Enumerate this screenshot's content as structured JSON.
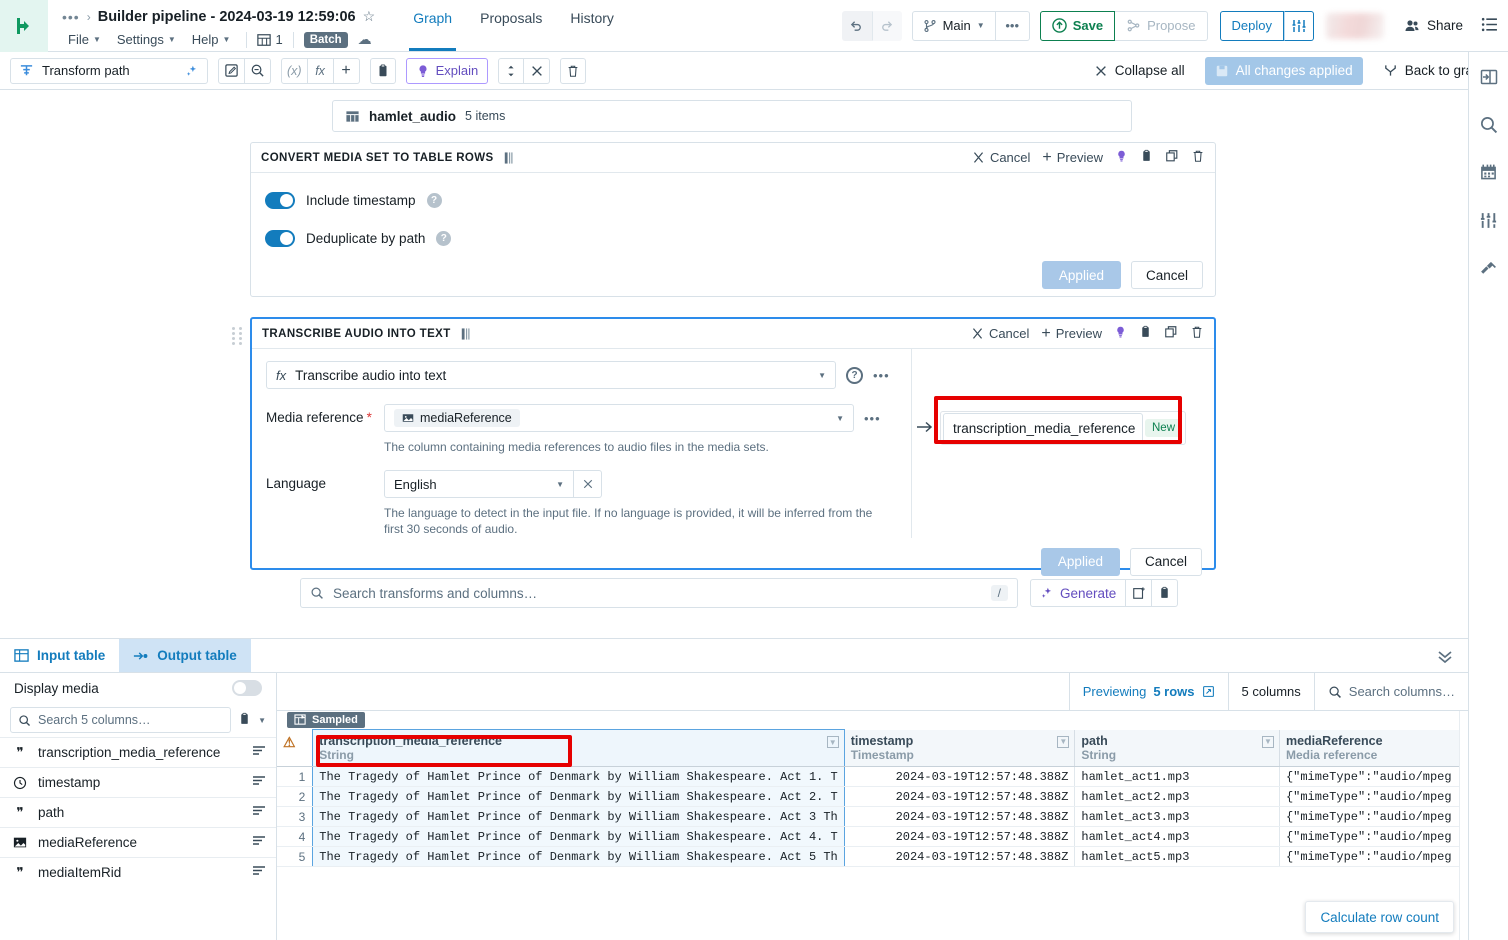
{
  "topbar": {
    "breadcrumb_dots": "•••",
    "breadcrumb_sep": "›",
    "doc_title": "Builder pipeline - 2024-03-19 12:59:06",
    "menus": [
      "File",
      "Settings",
      "Help"
    ],
    "branch_count": "1",
    "batch_label": "Batch",
    "tabs": [
      {
        "label": "Graph",
        "active": true
      },
      {
        "label": "Proposals",
        "active": false
      },
      {
        "label": "History",
        "active": false
      }
    ],
    "branch_name": "Main",
    "save_label": "Save",
    "propose_label": "Propose",
    "deploy_label": "Deploy",
    "share_label": "Share"
  },
  "toolbar": {
    "path_label": "Transform path",
    "explain_label": "Explain",
    "collapse_all_label": "Collapse all",
    "all_changes_label": "All changes applied",
    "back_to_graph_label": "Back to graph"
  },
  "canvas": {
    "node": {
      "name": "hamlet_audio",
      "count": "5 items"
    },
    "card_actions": {
      "cancel": "Cancel",
      "preview": "Preview"
    },
    "convert_card": {
      "title": "CONVERT MEDIA SET TO TABLE ROWS",
      "toggles": [
        {
          "label": "Include timestamp",
          "on": true
        },
        {
          "label": "Deduplicate by path",
          "on": true
        }
      ],
      "applied_label": "Applied",
      "cancel_label": "Cancel"
    },
    "transcribe_card": {
      "title": "TRANSCRIBE AUDIO INTO TEXT",
      "function_name": "Transcribe audio into text",
      "media_reference_label": "Media reference",
      "media_reference_value": "mediaReference",
      "media_reference_helper": "The column containing media references to audio files in the media sets.",
      "language_label": "Language",
      "language_value": "English",
      "language_helper": "The language to detect in the input file. If no language is provided, it will be inferred from the first 30 seconds of audio.",
      "output_column_value": "transcription_media_reference",
      "new_badge": "New",
      "applied_label": "Applied",
      "cancel_label": "Cancel"
    },
    "search": {
      "placeholder": "Search transforms and columns…",
      "shortcut": "/",
      "generate_label": "Generate"
    }
  },
  "bottom": {
    "tabs": [
      {
        "label": "Input table",
        "active": false
      },
      {
        "label": "Output table",
        "active": true
      }
    ],
    "display_media_label": "Display media",
    "display_media_on": false,
    "column_search_placeholder": "Search 5 columns…",
    "columns_list": [
      {
        "name": "transcription_media_reference",
        "type_icon": "string-icon"
      },
      {
        "name": "timestamp",
        "type_icon": "clock-icon"
      },
      {
        "name": "path",
        "type_icon": "string-icon"
      },
      {
        "name": "mediaReference",
        "type_icon": "image-icon"
      },
      {
        "name": "mediaItemRid",
        "type_icon": "string-icon"
      }
    ],
    "previewing_label": "Previewing",
    "previewing_rows": "5 rows",
    "columns_count": "5 columns",
    "search_columns_placeholder": "Search columns…",
    "sampled_label": "Sampled",
    "calculate_row_count_label": "Calculate row count",
    "table": {
      "columns": [
        {
          "name": "transcription_media_reference",
          "type": "String",
          "selected": true
        },
        {
          "name": "timestamp",
          "type": "Timestamp",
          "selected": false
        },
        {
          "name": "path",
          "type": "String",
          "selected": false
        },
        {
          "name": "mediaReference",
          "type": "Media reference",
          "selected": false
        }
      ],
      "rows": [
        {
          "n": "1",
          "transcription": "The Tragedy of Hamlet Prince of Denmark by William Shakespeare. Act 1. T",
          "timestamp": "2024-03-19T12:57:48.388Z",
          "path": "hamlet_act1.mp3",
          "mediaReference": "{\"mimeType\":\"audio/mpeg"
        },
        {
          "n": "2",
          "transcription": "The Tragedy of Hamlet Prince of Denmark by William Shakespeare. Act 2. T",
          "timestamp": "2024-03-19T12:57:48.388Z",
          "path": "hamlet_act2.mp3",
          "mediaReference": "{\"mimeType\":\"audio/mpeg"
        },
        {
          "n": "3",
          "transcription": "The Tragedy of Hamlet Prince of Denmark by William Shakespeare. Act 3 Th",
          "timestamp": "2024-03-19T12:57:48.388Z",
          "path": "hamlet_act3.mp3",
          "mediaReference": "{\"mimeType\":\"audio/mpeg"
        },
        {
          "n": "4",
          "transcription": "The Tragedy of Hamlet Prince of Denmark by William Shakespeare. Act 4. T",
          "timestamp": "2024-03-19T12:57:48.388Z",
          "path": "hamlet_act4.mp3",
          "mediaReference": "{\"mimeType\":\"audio/mpeg"
        },
        {
          "n": "5",
          "transcription": "The Tragedy of Hamlet Prince of Denmark by William Shakespeare. Act 5 Th",
          "timestamp": "2024-03-19T12:57:48.388Z",
          "path": "hamlet_act5.mp3",
          "mediaReference": "{\"mimeType\":\"audio/mpeg"
        }
      ]
    }
  },
  "colors": {
    "accent_blue": "#137cbd",
    "green": "#0d8050",
    "purple": "#634dbf",
    "highlight_red": "#e60000",
    "warn_orange": "#bf7326"
  }
}
